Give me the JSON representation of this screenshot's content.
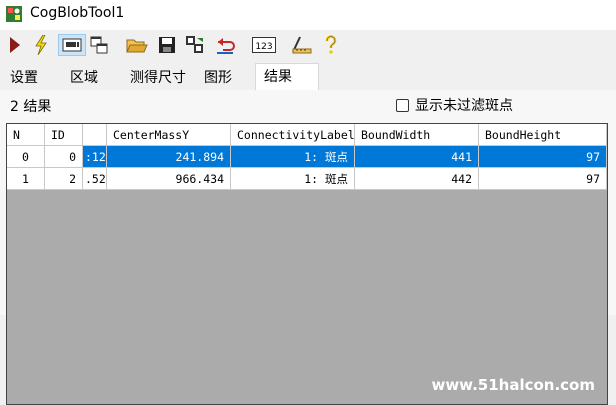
{
  "window": {
    "title": "CogBlobTool1"
  },
  "toolbar": {
    "buttons": [
      "run-icon",
      "electric-bolt-icon",
      "image-display-icon",
      "floating-window-icon",
      "open-folder-icon",
      "save-icon",
      "copy-image-icon",
      "reset-icon",
      "number-display-icon",
      "ruler-icon",
      "help-icon"
    ],
    "number_icon_text": "123"
  },
  "tabs": [
    "设置",
    "区域",
    "测得尺寸",
    "图形",
    "结果"
  ],
  "active_tab": "结果",
  "results": {
    "count_label": "2 结果",
    "show_unfiltered_label": "显示未过滤斑点",
    "show_unfiltered_checked": false
  },
  "table": {
    "columns": [
      "N",
      "ID",
      "",
      "CenterMassY",
      "ConnectivityLabel",
      "BoundWidth",
      "BoundHeight"
    ],
    "rows": [
      {
        "n": "0",
        "id": "0",
        "partial": ":12",
        "cmy": "241.894",
        "label": "1: 斑点",
        "bw": "441",
        "bh": "97",
        "selected": true
      },
      {
        "n": "1",
        "id": "2",
        "partial": ".52",
        "cmy": "966.434",
        "label": "1: 斑点",
        "bw": "442",
        "bh": "97",
        "selected": false
      }
    ]
  },
  "watermark": "www.51halcon.com"
}
